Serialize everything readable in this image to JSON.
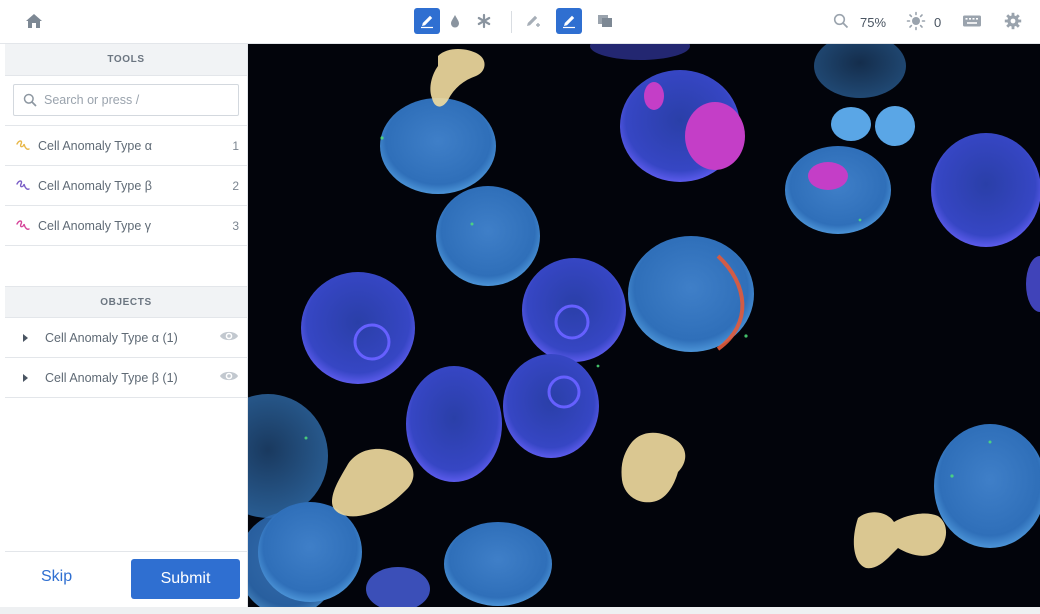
{
  "toolbar": {
    "zoom_value": "75%",
    "brightness_value": "0",
    "icons": [
      "home-icon",
      "pencil-icon",
      "droplet-icon",
      "asterisk-icon",
      "pencil-plus-icon",
      "pencil-minus-icon",
      "layers-icon",
      "zoom-icon",
      "brightness-icon",
      "keyboard-icon",
      "gear-icon"
    ]
  },
  "tools": {
    "header": "TOOLS",
    "search_placeholder": "Search or press /",
    "items": [
      {
        "label": "Cell Anomaly Type α",
        "key": "1",
        "color": "#e8b84a"
      },
      {
        "label": "Cell Anomaly Type β",
        "key": "2",
        "color": "#7b5fc7"
      },
      {
        "label": "Cell Anomaly Type γ",
        "key": "3",
        "color": "#d6469a"
      }
    ]
  },
  "objects": {
    "header": "OBJECTS",
    "items": [
      {
        "label": "Cell Anomaly Type α (1)"
      },
      {
        "label": "Cell Anomaly Type β (1)"
      }
    ]
  },
  "footer": {
    "skip_label": "Skip",
    "submit_label": "Submit"
  },
  "colors": {
    "accent": "#2f6fd1",
    "canvas_bg": "#02040b"
  }
}
